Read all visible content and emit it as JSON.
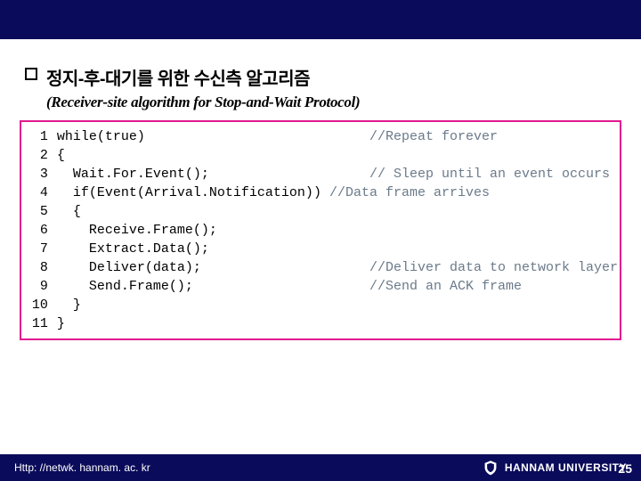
{
  "heading": "정지-후-대기를 위한 수신측 알고리즘",
  "subheading": "(Receiver-site algorithm for Stop-and-Wait Protocol)",
  "code": {
    "linenos": [
      "1",
      "2",
      "3",
      "4",
      "5",
      "6",
      "7",
      "8",
      "9",
      "10",
      "11"
    ],
    "lines": [
      {
        "text": "while(true)",
        "comment": "//Repeat forever",
        "comment_col": 39
      },
      {
        "text": "{",
        "comment": "",
        "comment_col": 0
      },
      {
        "text": "  Wait.For.Event();",
        "comment": "// Sleep until an event occurs",
        "comment_col": 39
      },
      {
        "text": "  if(Event(Arrival.Notification)) ",
        "comment": "//Data frame arrives",
        "comment_col": 34
      },
      {
        "text": "  {",
        "comment": "",
        "comment_col": 0
      },
      {
        "text": "    Receive.Frame();",
        "comment": "",
        "comment_col": 0
      },
      {
        "text": "    Extract.Data();",
        "comment": "",
        "comment_col": 0
      },
      {
        "text": "    Deliver(data);",
        "comment": "//Deliver data to network layer",
        "comment_col": 39
      },
      {
        "text": "    Send.Frame();",
        "comment": "//Send an ACK frame",
        "comment_col": 39
      },
      {
        "text": "  }",
        "comment": "",
        "comment_col": 0
      },
      {
        "text": "}",
        "comment": "",
        "comment_col": 0
      }
    ]
  },
  "footer": {
    "url": "Http: //netwk. hannam. ac. kr",
    "org": "HANNAM  UNIVERSITY",
    "page": "25"
  }
}
